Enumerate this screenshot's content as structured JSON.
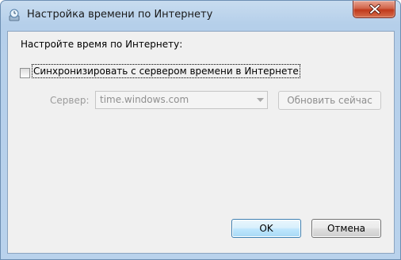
{
  "window": {
    "title": "Настройка времени по Интернету",
    "icon": "clock-globe-icon",
    "close_icon": "close-icon"
  },
  "dialog": {
    "prompt": "Настройте время по Интернету:",
    "sync_checkbox": {
      "label": "Синхронизировать с сервером времени в Интернете",
      "checked": false
    },
    "server": {
      "label": "Сервер:",
      "value": "time.windows.com",
      "enabled": false
    },
    "update_now_label": "Обновить сейчас",
    "ok_label": "OK",
    "cancel_label": "Отмена"
  },
  "colors": {
    "accent": "#3c7fb1",
    "close_red": "#c0391b",
    "disabled_text": "#8d8d8d"
  }
}
